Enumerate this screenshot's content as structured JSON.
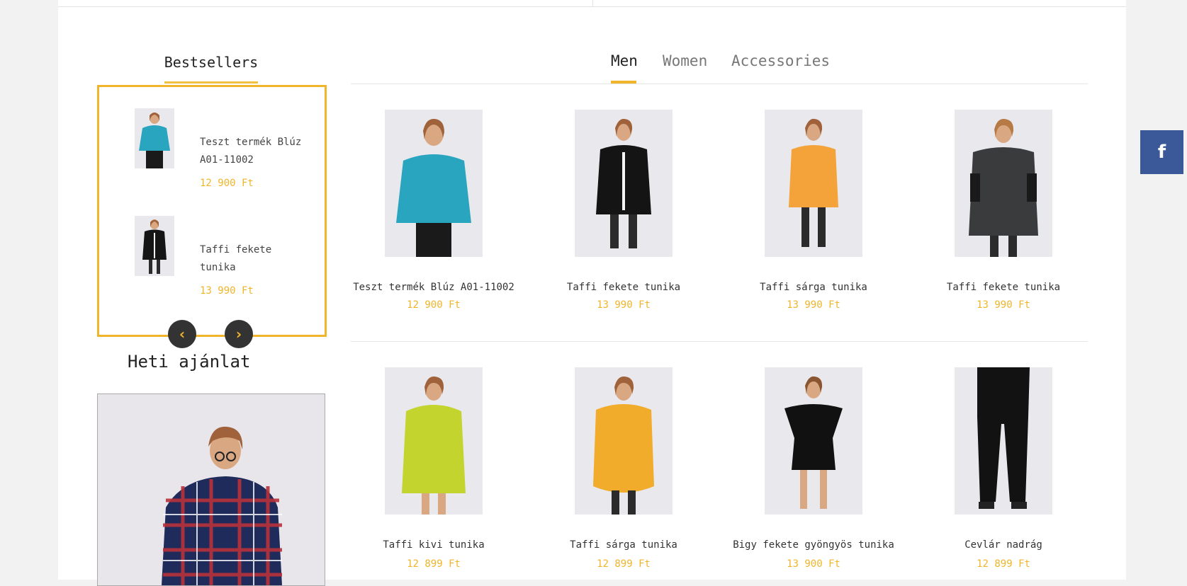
{
  "sidebar": {
    "bestsellers_title": "Bestsellers",
    "items": [
      {
        "name": "Teszt termék Blúz A01-11002",
        "price": "12 900 Ft",
        "garment": "teal-blouse"
      },
      {
        "name": "Taffi fekete tunika",
        "price": "13 990 Ft",
        "garment": "black-tunic"
      }
    ],
    "prev_icon": "‹",
    "next_icon": "›",
    "weekly_title": "Heti ajánlat"
  },
  "tabs": [
    {
      "label": "Men",
      "active": true
    },
    {
      "label": "Women",
      "active": false
    },
    {
      "label": "Accessories",
      "active": false
    }
  ],
  "products": [
    {
      "name": "Teszt termék Blúz A01-11002",
      "price": "12 900 Ft",
      "garment": "teal-blouse"
    },
    {
      "name": "Taffi fekete tunika",
      "price": "13 990 Ft",
      "garment": "black-tunic"
    },
    {
      "name": "Taffi sárga tunika",
      "price": "13 990 Ft",
      "garment": "orange-tunic"
    },
    {
      "name": "Taffi fekete tunika",
      "price": "13 990 Ft",
      "garment": "grey-tunic"
    },
    {
      "name": "Taffi kivi tunika",
      "price": "12 899 Ft",
      "garment": "kiwi-tunic"
    },
    {
      "name": "Taffi sárga tunika",
      "price": "12 899 Ft",
      "garment": "mustard-tunic"
    },
    {
      "name": "Bigy fekete gyöngyös tunika",
      "price": "13 900 Ft",
      "garment": "black-dress"
    },
    {
      "name": "Cevlár nadrág",
      "price": "12 899 Ft",
      "garment": "black-trousers"
    }
  ],
  "social": {
    "facebook_icon": "f"
  },
  "colors": {
    "accent": "#f0b52a",
    "facebook": "#3b5998",
    "nav_button": "#333333"
  }
}
